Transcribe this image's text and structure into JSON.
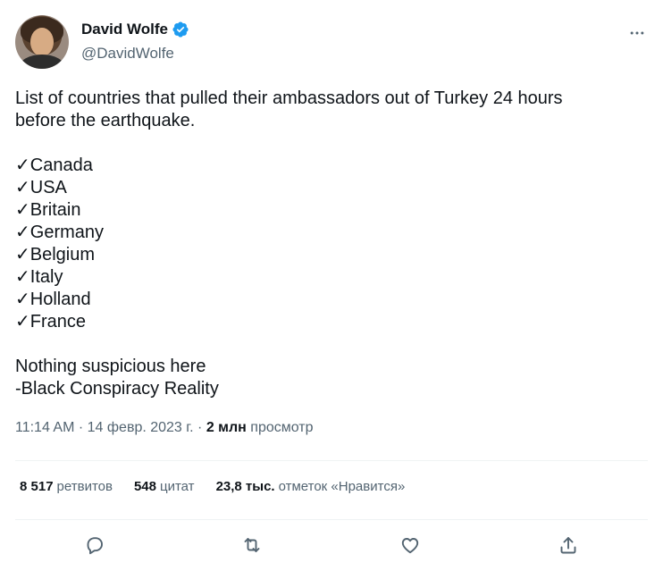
{
  "author": {
    "display_name": "David Wolfe",
    "handle": "@DavidWolfe",
    "verified": true
  },
  "tweet": {
    "lines": [
      "List of countries that pulled their ambassadors out of Turkey 24 hours",
      "before the earthquake.",
      "",
      "✓Canada",
      "✓USA",
      "✓Britain",
      "✓Germany",
      "✓Belgium",
      "✓Italy",
      "✓Holland",
      "✓France",
      "",
      "Nothing suspicious here",
      "-Black Conspiracy Reality"
    ]
  },
  "meta": {
    "time": "11:14 AM",
    "separator1": " · ",
    "date": "14 февр. 2023 г.",
    "separator2": " · ",
    "views_count": "2 млн",
    "views_label": "просмотр"
  },
  "stats": {
    "retweets_count": "8 517",
    "retweets_label": "ретвитов",
    "quotes_count": "548",
    "quotes_label": "цитат",
    "likes_count": "23,8 тыс.",
    "likes_label": "отметок «Нравится»"
  },
  "icons": {
    "more": "more-horizontal-icon",
    "verified": "verified-badge-icon",
    "reply": "reply-icon",
    "retweet": "retweet-icon",
    "like": "heart-icon",
    "share": "share-icon"
  },
  "colors": {
    "verified_blue": "#1d9bf0",
    "text_primary": "#0f1419",
    "text_secondary": "#536471",
    "divider": "#eff3f4"
  }
}
